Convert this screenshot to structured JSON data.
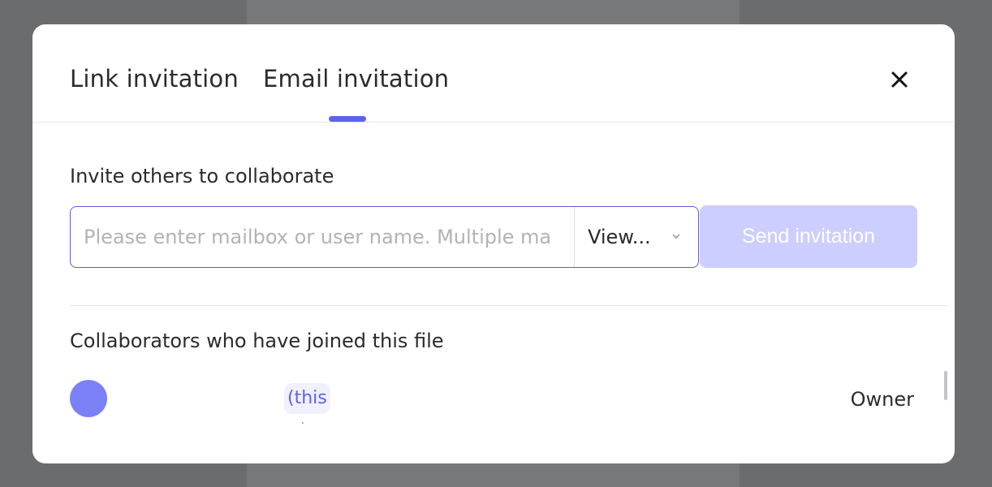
{
  "tabs": {
    "link_label": "Link invitation",
    "email_label": "Email invitation",
    "active": "email"
  },
  "invite": {
    "title": "Invite others to collaborate",
    "placeholder": "Please enter mailbox or user name. Multiple ma",
    "permission_value": "View...",
    "send_label": "Send invitation"
  },
  "collaborators": {
    "title": "Collaborators who have joined this file",
    "items": [
      {
        "name": "",
        "self_tag": "(this",
        "role": "Owner"
      }
    ]
  },
  "icons": {
    "close": "close-icon",
    "chevron": "chevron-down-icon"
  },
  "colors": {
    "accent": "#5b62f0",
    "send_disabled": "#ccceff",
    "avatar": "#7b80f6"
  }
}
